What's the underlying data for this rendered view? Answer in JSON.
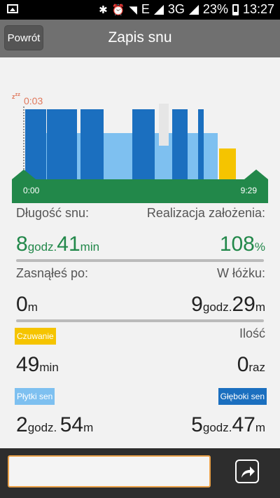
{
  "status_bar": {
    "network": "E",
    "network2": "3G",
    "battery": "23%",
    "time": "13:27"
  },
  "header": {
    "back_label": "Powrót",
    "title": "Zapis snu"
  },
  "chart_data": {
    "type": "bar",
    "start_label": "0:03",
    "x_start": "0:00",
    "x_end": "9:29",
    "series": [
      {
        "name": "Głęboki sen",
        "color": "#1b6fbf"
      },
      {
        "name": "Płytki sen",
        "color": "#7ec0f0"
      },
      {
        "name": "Czuwanie",
        "color": "#f5c400"
      }
    ]
  },
  "stats": {
    "row1": {
      "left_label": "Długość snu:",
      "right_label": "Realizacja założenia:",
      "hours": "8",
      "hours_unit": "godz.",
      "minutes": "41",
      "minutes_unit": "min",
      "percent": "108",
      "percent_unit": "%"
    },
    "row2": {
      "left_label": "Zasnąłeś po:",
      "right_label": "W łóżku:",
      "left_value": "0",
      "left_unit": "m",
      "right_hours": "9",
      "right_hours_unit": "godz.",
      "right_minutes": "29",
      "right_minutes_unit": "m"
    },
    "row3": {
      "tag": "Czuwanie",
      "right_label": "Ilość",
      "left_value": "49",
      "left_unit": "min",
      "right_value": "0",
      "right_unit": "raz"
    },
    "row4": {
      "left_tag": "Płytki sen",
      "right_tag": "Głęboki sen",
      "left_hours": "2",
      "left_hours_unit": "godz.",
      "left_minutes": "54",
      "left_minutes_unit": "m",
      "right_hours": "5",
      "right_hours_unit": "godz.",
      "right_minutes": "47",
      "right_minutes_unit": "m"
    }
  },
  "bottom": {
    "note_value": "",
    "share_icon": "share-icon"
  },
  "colors": {
    "green": "#22884a",
    "title_bar": "#707070",
    "accent_orange": "#e9a048"
  }
}
